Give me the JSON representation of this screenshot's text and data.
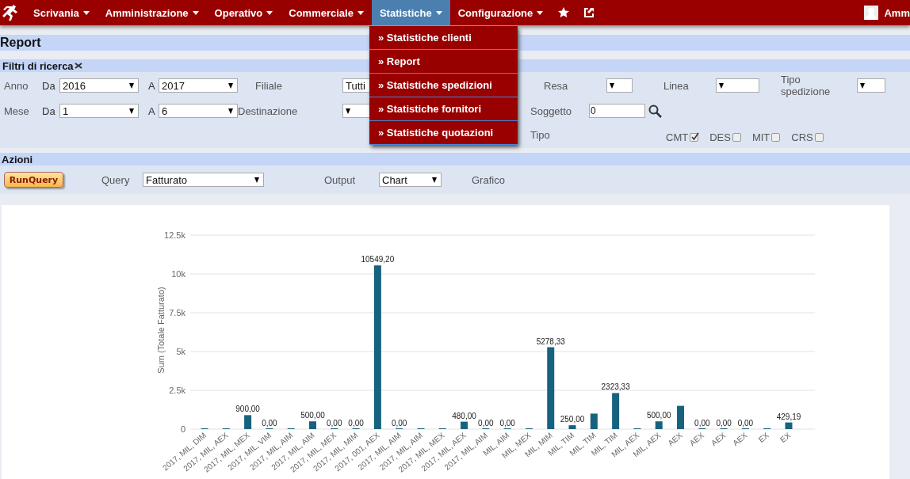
{
  "nav": {
    "items": [
      {
        "label": "Scrivania",
        "selected": false
      },
      {
        "label": "Amministrazione",
        "selected": false
      },
      {
        "label": "Operativo",
        "selected": false
      },
      {
        "label": "Commerciale",
        "selected": false
      },
      {
        "label": "Statistiche",
        "selected": true
      },
      {
        "label": "Configurazione",
        "selected": false
      }
    ],
    "user": "Amm"
  },
  "menu": [
    "» Statistiche clienti",
    "» Report",
    "» Statistiche spedizioni",
    "» Statistiche fornitori",
    "» Statistiche quotazioni"
  ],
  "page_title": "Report",
  "filters": {
    "title": "Filtri di ricerca",
    "anno": {
      "label": "Anno",
      "from_label": "Da",
      "from": "2016",
      "to_label": "A",
      "to": "2017"
    },
    "mese": {
      "label": "Mese",
      "from_label": "Da",
      "from": "1",
      "to_label": "A",
      "to": "6"
    },
    "filiale": {
      "label": "Filiale",
      "value": "Tutti"
    },
    "destinazione": {
      "label": "Destinazione"
    },
    "resa": {
      "label": "Resa"
    },
    "linea": {
      "label": "Linea"
    },
    "tipo_spedizione": {
      "label": "Tipo spedizione"
    },
    "soggetto": {
      "label": "Soggetto",
      "value": "0"
    },
    "tipo": {
      "label": "Tipo",
      "options": [
        {
          "label": "CMT",
          "checked": true
        },
        {
          "label": "DES",
          "checked": false
        },
        {
          "label": "MIT",
          "checked": false
        },
        {
          "label": "CRS",
          "checked": false
        }
      ]
    }
  },
  "actions": {
    "title": "Azioni",
    "run_button": "RunQuery",
    "query_label": "Query",
    "query": "Fatturato",
    "output_label": "Output",
    "output": "Chart",
    "grafico_label": "Grafico"
  },
  "chart_data": {
    "type": "bar",
    "grid": true,
    "ylim": [
      0,
      12500
    ],
    "ylabel": "Sum (Totale Fatturato)",
    "yticks": [
      {
        "value": 0,
        "label": "0"
      },
      {
        "value": 2500,
        "label": "2.5k"
      },
      {
        "value": 5000,
        "label": "5k"
      },
      {
        "value": 7500,
        "label": "7.5k"
      },
      {
        "value": 10000,
        "label": "10k"
      },
      {
        "value": 12500,
        "label": "12.5k"
      }
    ],
    "categories": [
      "2017, MIL, DIM",
      "2017, MIL, AEX",
      "2017, MIL, MEX",
      "2017, MIL, VIM",
      "2017, MIL, AIM",
      "2017, MIL, AIM",
      "2017, MIL, MEX",
      "2017, MIL, MIM",
      "2017, 001, AEX",
      "2017, MIL, AIM",
      "2017, MIL, AIM",
      "2017, MIL, MEX",
      "2017, MIL, AEX",
      "2017, MIL, AIM",
      "MIL, AIM",
      "MIL, MEX",
      "MIL, MIM",
      "MIL, TIM",
      "MIL, TIM",
      "MIL, TIM",
      "MIL, AEX",
      "MIL, AEX",
      "AEX",
      "AEX",
      "AEX",
      "AEX",
      "EX",
      "EX"
    ],
    "values": [
      0,
      0,
      900,
      0,
      0,
      500,
      0,
      0,
      10549.2,
      0,
      0,
      0,
      480,
      0,
      0,
      0,
      5278.33,
      250,
      1000,
      2323.33,
      0,
      500,
      1500,
      0,
      0,
      0,
      0,
      429.19
    ],
    "value_labels": [
      null,
      null,
      "900,00",
      "0,00",
      null,
      "500,00",
      "0,00",
      "0,00",
      "10549,20",
      "0,00",
      null,
      null,
      "480,00",
      "0,00",
      "0,00",
      null,
      "5278,33",
      "250,00",
      null,
      "2323,33",
      null,
      "500,00",
      null,
      "0,00",
      "0,00",
      "0,00",
      null,
      "429,19"
    ]
  }
}
